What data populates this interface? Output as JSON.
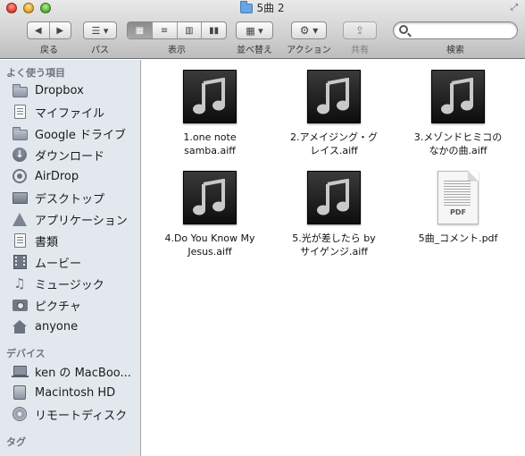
{
  "window": {
    "title": "5曲 2"
  },
  "toolbar": {
    "back_label": "戻る",
    "path_label": "パス",
    "view_label": "表示",
    "arrange_label": "並べ替え",
    "action_label": "アクション",
    "share_label": "共有",
    "search_label": "検索",
    "search_placeholder": ""
  },
  "sidebar": {
    "favorites_heading": "よく使う項目",
    "favorites": [
      {
        "label": "Dropbox",
        "icon": "folder-icon"
      },
      {
        "label": "マイファイル",
        "icon": "all-files-icon"
      },
      {
        "label": "Google ドライブ",
        "icon": "folder-icon"
      },
      {
        "label": "ダウンロード",
        "icon": "download-icon"
      },
      {
        "label": "AirDrop",
        "icon": "airdrop-icon"
      },
      {
        "label": "デスクトップ",
        "icon": "desktop-icon"
      },
      {
        "label": "アプリケーション",
        "icon": "applications-icon"
      },
      {
        "label": "書類",
        "icon": "documents-icon"
      },
      {
        "label": "ムービー",
        "icon": "movies-icon"
      },
      {
        "label": "ミュージック",
        "icon": "music-icon"
      },
      {
        "label": "ピクチャ",
        "icon": "pictures-icon"
      },
      {
        "label": "anyone",
        "icon": "home-icon"
      }
    ],
    "devices_heading": "デバイス",
    "devices": [
      {
        "label": "ken の MacBoo...",
        "icon": "laptop-icon"
      },
      {
        "label": "Macintosh HD",
        "icon": "hard-drive-icon"
      },
      {
        "label": "リモートディスク",
        "icon": "remote-disc-icon"
      }
    ],
    "tags_heading": "タグ"
  },
  "files": [
    {
      "name_line1": "1.one note",
      "name_line2": "samba.aiff",
      "icon": "music-file-icon"
    },
    {
      "name_line1": "2.アメイジング・グ",
      "name_line2": "レイス.aiff",
      "icon": "music-file-icon"
    },
    {
      "name_line1": "3.メゾンドヒミコの",
      "name_line2": "なかの曲.aiff",
      "icon": "music-file-icon"
    },
    {
      "name_line1": "4.Do You Know My",
      "name_line2": "Jesus.aiff",
      "icon": "music-file-icon"
    },
    {
      "name_line1": "5.光が差したら by",
      "name_line2": "サイゲンジ.aiff",
      "icon": "music-file-icon"
    },
    {
      "name_line1": "5曲_コメント.pdf",
      "name_line2": "",
      "icon": "pdf-file-icon",
      "badge": "PDF"
    }
  ]
}
